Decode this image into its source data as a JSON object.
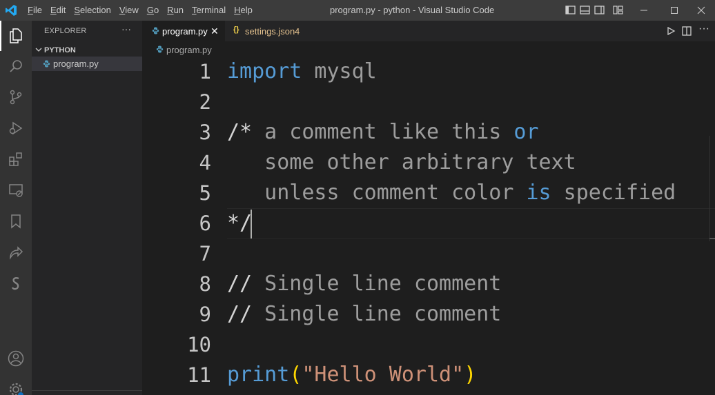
{
  "window": {
    "title": "program.py - python - Visual Studio Code",
    "menu": [
      "File",
      "Edit",
      "Selection",
      "View",
      "Go",
      "Run",
      "Terminal",
      "Help"
    ],
    "menu_mnemonics": [
      "F",
      "E",
      "S",
      "V",
      "G",
      "R",
      "T",
      "H"
    ]
  },
  "activity_bar": {
    "items": [
      "files-icon",
      "search-icon",
      "source-control-icon",
      "run-debug-icon",
      "extensions-icon",
      "remote-explorer-icon",
      "bookmark-icon",
      "live-share-icon",
      "s-extension-icon"
    ],
    "bottom": [
      "account-icon",
      "settings-gear-icon"
    ]
  },
  "sidebar": {
    "header": "EXPLORER",
    "more": "···",
    "folder": "PYTHON",
    "files": [
      {
        "name": "program.py"
      }
    ]
  },
  "tabs": [
    {
      "label": "program.py",
      "active": true,
      "close": "✕"
    },
    {
      "label": "settings.json",
      "badge": "4",
      "icon_text": "{}"
    }
  ],
  "breadcrumb": {
    "file": "program.py"
  },
  "editor": {
    "line_numbers": [
      "1",
      "2",
      "3",
      "4",
      "5",
      "6",
      "7",
      "8",
      "9",
      "10",
      "11"
    ],
    "lines": [
      {
        "parts": [
          {
            "t": "import",
            "c": "kw"
          },
          {
            "t": " mysql",
            "c": ""
          }
        ]
      },
      {
        "parts": []
      },
      {
        "parts": [
          {
            "t": "/*",
            "c": "op"
          },
          {
            "t": " a comment like this ",
            "c": ""
          },
          {
            "t": "or",
            "c": "kw"
          }
        ]
      },
      {
        "parts": [
          {
            "t": "   some other arbitrary text",
            "c": ""
          }
        ]
      },
      {
        "parts": [
          {
            "t": "   unless comment color ",
            "c": ""
          },
          {
            "t": "is",
            "c": "kw"
          },
          {
            "t": " specified",
            "c": ""
          }
        ]
      },
      {
        "parts": [
          {
            "t": "*/",
            "c": "op"
          }
        ]
      },
      {
        "parts": []
      },
      {
        "parts": [
          {
            "t": "//",
            "c": "op"
          },
          {
            "t": " Single line comment",
            "c": ""
          }
        ]
      },
      {
        "parts": [
          {
            "t": "//",
            "c": "op"
          },
          {
            "t": " Single line comment",
            "c": ""
          }
        ]
      },
      {
        "parts": []
      },
      {
        "parts": [
          {
            "t": "print",
            "c": "fn"
          },
          {
            "t": "(",
            "c": "paren"
          },
          {
            "t": "\"Hello World\"",
            "c": "str"
          },
          {
            "t": ")",
            "c": "paren"
          }
        ]
      }
    ]
  },
  "colors": {
    "keyword": "#569cd6",
    "comment_text": "#9d9d9d",
    "string": "#ce9178",
    "paren": "#ffd700",
    "settings_tab": "#e2c08d"
  }
}
